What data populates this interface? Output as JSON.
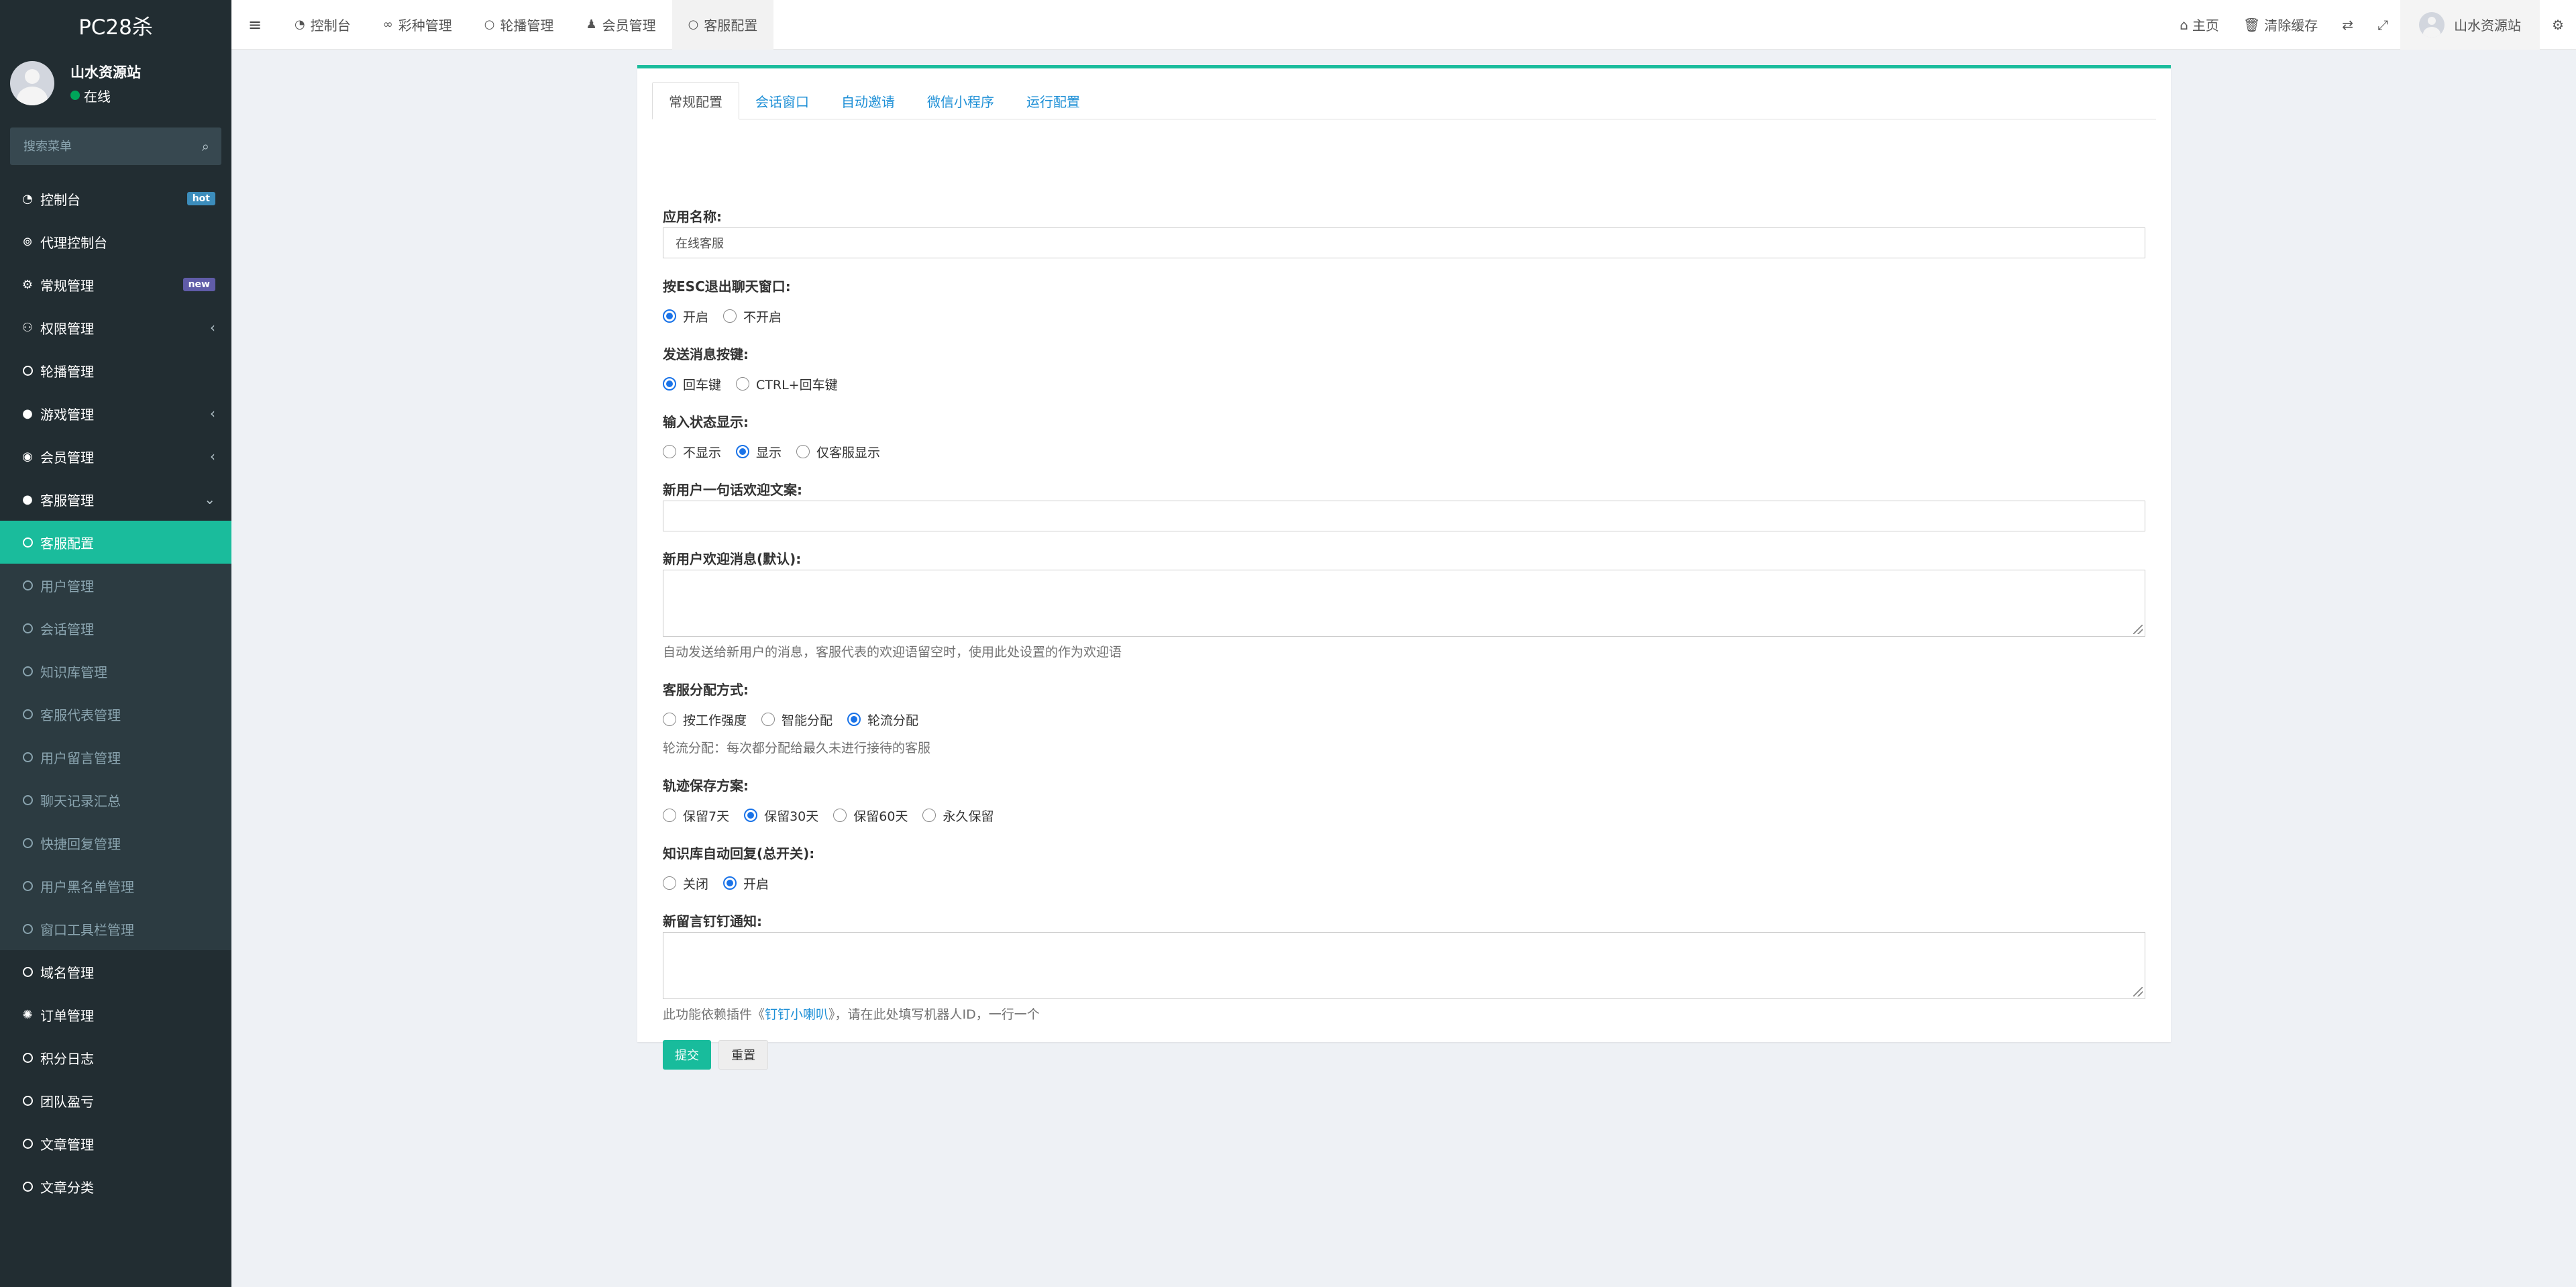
{
  "brand": "PC28杀",
  "user": {
    "name": "山水资源站",
    "status": "在线"
  },
  "search": {
    "placeholder": "搜索菜单"
  },
  "menu": [
    {
      "label": "控制台",
      "icon": "dashboard-icon",
      "badge": "hot"
    },
    {
      "label": "代理控制台",
      "icon": "agent-icon"
    },
    {
      "label": "常规管理",
      "icon": "cogs-icon",
      "badge": "new"
    },
    {
      "label": "权限管理",
      "icon": "group-icon"
    },
    {
      "label": "轮播管理",
      "icon": "circle-icon"
    },
    {
      "label": "游戏管理",
      "icon": "bomb-icon"
    },
    {
      "label": "会员管理",
      "icon": "user-circle-icon"
    },
    {
      "label": "客服管理",
      "icon": "comment-icon"
    }
  ],
  "submenu": [
    "客服配置",
    "用户管理",
    "会话管理",
    "知识库管理",
    "客服代表管理",
    "用户留言管理",
    "聊天记录汇总",
    "快捷回复管理",
    "用户黑名单管理",
    "窗口工具栏管理"
  ],
  "menu_after": [
    {
      "label": "域名管理",
      "icon": "circle-icon"
    },
    {
      "label": "订单管理",
      "icon": "gear-icon"
    },
    {
      "label": "积分日志",
      "icon": "circle-icon"
    },
    {
      "label": "团队盈亏",
      "icon": "circle-icon"
    },
    {
      "label": "文章管理",
      "icon": "circle-icon"
    },
    {
      "label": "文章分类",
      "icon": "circle-icon"
    }
  ],
  "topbar": {
    "tabs": [
      {
        "label": "控制台",
        "icon": "dashboard-icon"
      },
      {
        "label": "彩种管理",
        "icon": "gamepad-icon"
      },
      {
        "label": "轮播管理",
        "icon": "circle-icon"
      },
      {
        "label": "会员管理",
        "icon": "user-icon"
      },
      {
        "label": "客服配置",
        "icon": "circle-icon"
      }
    ],
    "home": "主页",
    "clear_cache": "清除缓存",
    "username": "山水资源站"
  },
  "content_tabs": [
    "常规配置",
    "会话窗口",
    "自动邀请",
    "微信小程序",
    "运行配置"
  ],
  "form": {
    "app_name_label": "应用名称:",
    "app_name_value": "在线客服",
    "esc_label": "按ESC退出聊天窗口:",
    "esc_options": [
      "开启",
      "不开启"
    ],
    "esc_selected": 0,
    "send_key_label": "发送消息按键:",
    "send_key_options": [
      "回车键",
      "CTRL+回车键"
    ],
    "send_key_selected": 0,
    "typing_label": "输入状态显示:",
    "typing_options": [
      "不显示",
      "显示",
      "仅客服显示"
    ],
    "typing_selected": 1,
    "welcome_one_label": "新用户一句话欢迎文案:",
    "welcome_msg_label": "新用户欢迎消息(默认):",
    "welcome_msg_help": "自动发送给新用户的消息，客服代表的欢迎语留空时，使用此处设置的作为欢迎语",
    "assign_label": "客服分配方式:",
    "assign_options": [
      "按工作强度",
      "智能分配",
      "轮流分配"
    ],
    "assign_selected": 2,
    "assign_help": "轮流分配：每次都分配给最久未进行接待的客服",
    "track_label": "轨迹保存方案:",
    "track_options": [
      "保留7天",
      "保留30天",
      "保留60天",
      "永久保留"
    ],
    "track_selected": 1,
    "kb_label": "知识库自动回复(总开关):",
    "kb_options": [
      "关闭",
      "开启"
    ],
    "kb_selected": 1,
    "dingtalk_label": "新留言钉钉通知:",
    "dingtalk_help_pre": "此功能依赖插件《",
    "dingtalk_help_link": "钉钉小喇叭",
    "dingtalk_help_post": "》，请在此处填写机器人ID，一行一个",
    "submit": "提交",
    "reset": "重置"
  }
}
